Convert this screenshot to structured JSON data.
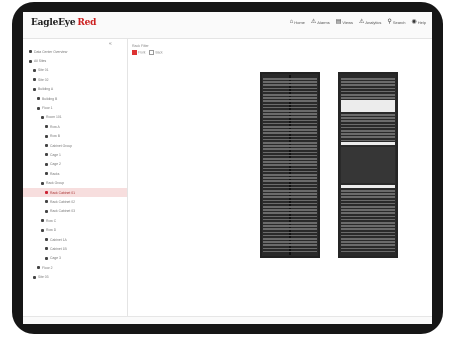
{
  "app": {
    "brand_primary": "EagleEye",
    "brand_accent": "Red",
    "accent_color": "#cc1f1f"
  },
  "nav": [
    {
      "icon": "home-icon",
      "glyph": "⌂",
      "label": "Home"
    },
    {
      "icon": "alarm-icon",
      "glyph": "⚠",
      "label": "Alarms"
    },
    {
      "icon": "rack-icon",
      "glyph": "▤",
      "label": "Views"
    },
    {
      "icon": "analytics-icon",
      "glyph": "⚠",
      "label": "Analytics"
    },
    {
      "icon": "search-icon",
      "glyph": "⚲",
      "label": "Search"
    },
    {
      "icon": "help-icon",
      "glyph": "◉",
      "label": "Help"
    }
  ],
  "sidebar": {
    "collapse_glyph": "«",
    "items": [
      {
        "label": "Data Center Overview",
        "indent": 0
      },
      {
        "label": "All Sites",
        "indent": 0
      },
      {
        "label": "Site 01",
        "indent": 1
      },
      {
        "label": "Site 02",
        "indent": 1
      },
      {
        "label": "Building A",
        "indent": 1
      },
      {
        "label": "Building B",
        "indent": 2
      },
      {
        "label": "Floor 1",
        "indent": 2
      },
      {
        "label": "Room 101",
        "indent": 3
      },
      {
        "label": "Row A",
        "indent": 4
      },
      {
        "label": "Row B",
        "indent": 4
      },
      {
        "label": "Cabinet Group",
        "indent": 4
      },
      {
        "label": "Cage 1",
        "indent": 4
      },
      {
        "label": "Cage 2",
        "indent": 4
      },
      {
        "label": "Racks",
        "indent": 4
      },
      {
        "label": "Rack Group",
        "indent": 3
      },
      {
        "label": "Rack Cabinet 01",
        "indent": 4,
        "selected": true
      },
      {
        "label": "Rack Cabinet 02",
        "indent": 4
      },
      {
        "label": "Rack Cabinet 03",
        "indent": 4
      },
      {
        "label": "Row C",
        "indent": 3
      },
      {
        "label": "Row D",
        "indent": 3
      },
      {
        "label": "Cabinet 1A",
        "indent": 4
      },
      {
        "label": "Cabinet 1B",
        "indent": 4
      },
      {
        "label": "Cage 3",
        "indent": 4
      },
      {
        "label": "Floor 2",
        "indent": 2
      },
      {
        "label": "Site 03",
        "indent": 1
      }
    ]
  },
  "main": {
    "filter_title": "Rack Filter",
    "options": [
      {
        "label": "Front",
        "checked": true
      },
      {
        "label": "Back",
        "checked": false
      }
    ]
  },
  "status_bar": {
    "text": ""
  }
}
